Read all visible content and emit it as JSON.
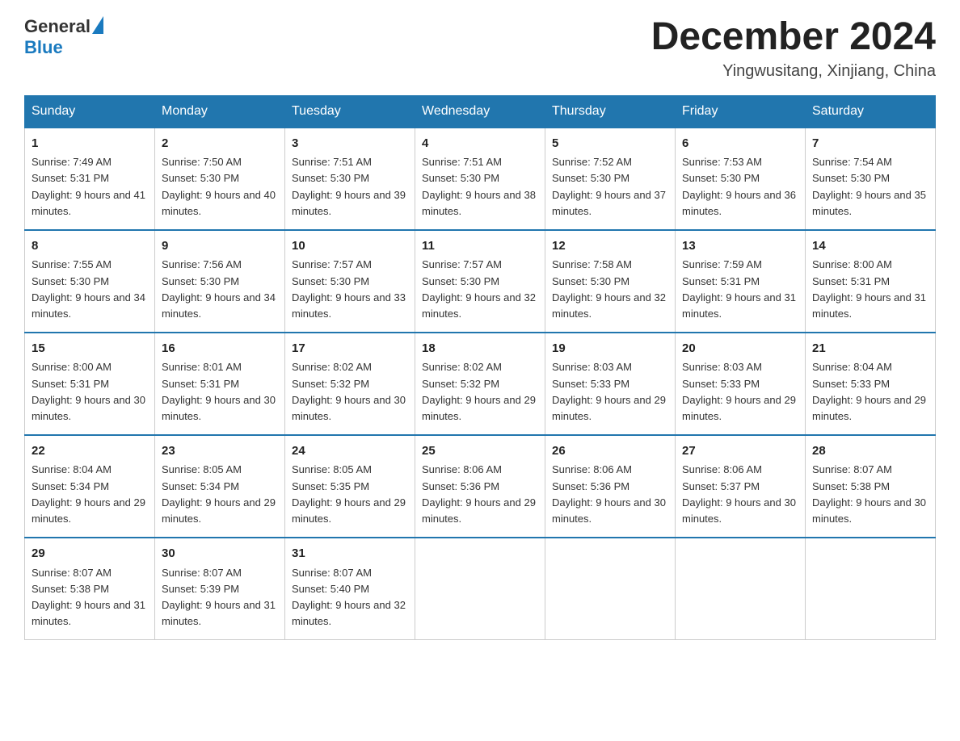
{
  "header": {
    "logo_general": "General",
    "logo_blue": "Blue",
    "month": "December 2024",
    "location": "Yingwusitang, Xinjiang, China"
  },
  "weekdays": [
    "Sunday",
    "Monday",
    "Tuesday",
    "Wednesday",
    "Thursday",
    "Friday",
    "Saturday"
  ],
  "weeks": [
    [
      {
        "day": "1",
        "sunrise": "7:49 AM",
        "sunset": "5:31 PM",
        "daylight": "9 hours and 41 minutes."
      },
      {
        "day": "2",
        "sunrise": "7:50 AM",
        "sunset": "5:30 PM",
        "daylight": "9 hours and 40 minutes."
      },
      {
        "day": "3",
        "sunrise": "7:51 AM",
        "sunset": "5:30 PM",
        "daylight": "9 hours and 39 minutes."
      },
      {
        "day": "4",
        "sunrise": "7:51 AM",
        "sunset": "5:30 PM",
        "daylight": "9 hours and 38 minutes."
      },
      {
        "day": "5",
        "sunrise": "7:52 AM",
        "sunset": "5:30 PM",
        "daylight": "9 hours and 37 minutes."
      },
      {
        "day": "6",
        "sunrise": "7:53 AM",
        "sunset": "5:30 PM",
        "daylight": "9 hours and 36 minutes."
      },
      {
        "day": "7",
        "sunrise": "7:54 AM",
        "sunset": "5:30 PM",
        "daylight": "9 hours and 35 minutes."
      }
    ],
    [
      {
        "day": "8",
        "sunrise": "7:55 AM",
        "sunset": "5:30 PM",
        "daylight": "9 hours and 34 minutes."
      },
      {
        "day": "9",
        "sunrise": "7:56 AM",
        "sunset": "5:30 PM",
        "daylight": "9 hours and 34 minutes."
      },
      {
        "day": "10",
        "sunrise": "7:57 AM",
        "sunset": "5:30 PM",
        "daylight": "9 hours and 33 minutes."
      },
      {
        "day": "11",
        "sunrise": "7:57 AM",
        "sunset": "5:30 PM",
        "daylight": "9 hours and 32 minutes."
      },
      {
        "day": "12",
        "sunrise": "7:58 AM",
        "sunset": "5:30 PM",
        "daylight": "9 hours and 32 minutes."
      },
      {
        "day": "13",
        "sunrise": "7:59 AM",
        "sunset": "5:31 PM",
        "daylight": "9 hours and 31 minutes."
      },
      {
        "day": "14",
        "sunrise": "8:00 AM",
        "sunset": "5:31 PM",
        "daylight": "9 hours and 31 minutes."
      }
    ],
    [
      {
        "day": "15",
        "sunrise": "8:00 AM",
        "sunset": "5:31 PM",
        "daylight": "9 hours and 30 minutes."
      },
      {
        "day": "16",
        "sunrise": "8:01 AM",
        "sunset": "5:31 PM",
        "daylight": "9 hours and 30 minutes."
      },
      {
        "day": "17",
        "sunrise": "8:02 AM",
        "sunset": "5:32 PM",
        "daylight": "9 hours and 30 minutes."
      },
      {
        "day": "18",
        "sunrise": "8:02 AM",
        "sunset": "5:32 PM",
        "daylight": "9 hours and 29 minutes."
      },
      {
        "day": "19",
        "sunrise": "8:03 AM",
        "sunset": "5:33 PM",
        "daylight": "9 hours and 29 minutes."
      },
      {
        "day": "20",
        "sunrise": "8:03 AM",
        "sunset": "5:33 PM",
        "daylight": "9 hours and 29 minutes."
      },
      {
        "day": "21",
        "sunrise": "8:04 AM",
        "sunset": "5:33 PM",
        "daylight": "9 hours and 29 minutes."
      }
    ],
    [
      {
        "day": "22",
        "sunrise": "8:04 AM",
        "sunset": "5:34 PM",
        "daylight": "9 hours and 29 minutes."
      },
      {
        "day": "23",
        "sunrise": "8:05 AM",
        "sunset": "5:34 PM",
        "daylight": "9 hours and 29 minutes."
      },
      {
        "day": "24",
        "sunrise": "8:05 AM",
        "sunset": "5:35 PM",
        "daylight": "9 hours and 29 minutes."
      },
      {
        "day": "25",
        "sunrise": "8:06 AM",
        "sunset": "5:36 PM",
        "daylight": "9 hours and 29 minutes."
      },
      {
        "day": "26",
        "sunrise": "8:06 AM",
        "sunset": "5:36 PM",
        "daylight": "9 hours and 30 minutes."
      },
      {
        "day": "27",
        "sunrise": "8:06 AM",
        "sunset": "5:37 PM",
        "daylight": "9 hours and 30 minutes."
      },
      {
        "day": "28",
        "sunrise": "8:07 AM",
        "sunset": "5:38 PM",
        "daylight": "9 hours and 30 minutes."
      }
    ],
    [
      {
        "day": "29",
        "sunrise": "8:07 AM",
        "sunset": "5:38 PM",
        "daylight": "9 hours and 31 minutes."
      },
      {
        "day": "30",
        "sunrise": "8:07 AM",
        "sunset": "5:39 PM",
        "daylight": "9 hours and 31 minutes."
      },
      {
        "day": "31",
        "sunrise": "8:07 AM",
        "sunset": "5:40 PM",
        "daylight": "9 hours and 32 minutes."
      },
      null,
      null,
      null,
      null
    ]
  ]
}
